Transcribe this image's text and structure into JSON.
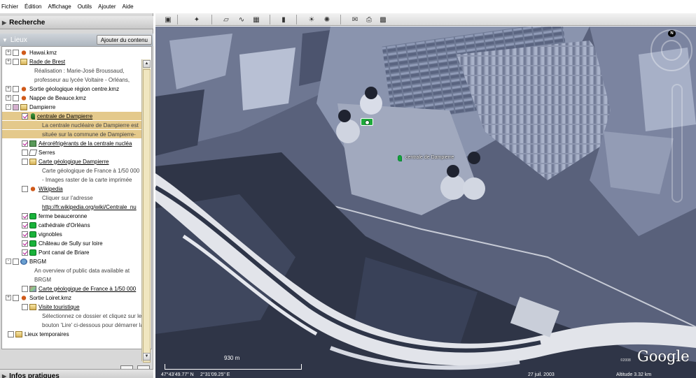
{
  "menu": [
    "Fichier",
    "Édition",
    "Affichage",
    "Outils",
    "Ajouter",
    "Aide"
  ],
  "panels": {
    "recherche": "Recherche",
    "lieux": "Lieux",
    "add_content": "Ajouter du contenu",
    "infos": "Infos pratiques"
  },
  "tree": [
    {
      "label": "Hawai.kmz",
      "icon": "kmz",
      "exp": "+",
      "check": "off"
    },
    {
      "label": "Rade de Brest",
      "icon": "folder",
      "exp": "+",
      "check": "off",
      "link": true
    },
    {
      "label": "Réalisation : Marie-José Broussaud,",
      "sub": true
    },
    {
      "label": "professeur au lycée Voltaire - Orléans,",
      "sub": true
    },
    {
      "label": "Sortie géologique région centre.kmz",
      "icon": "kmz",
      "exp": "+",
      "check": "off"
    },
    {
      "label": "Nappe de Beauce.kmz",
      "icon": "kmz",
      "exp": "+",
      "check": "off"
    },
    {
      "label": "Dampierre",
      "icon": "folder",
      "exp": "-",
      "check": "partial"
    },
    {
      "label": "centrale de Dampierre",
      "icon": "pin",
      "check": "on",
      "link": true,
      "selected": true
    },
    {
      "label": "La centrale nucléaire de Dampierre est",
      "sub": true,
      "selected": true
    },
    {
      "label": "située sur la commune de Dampierre-",
      "sub": true,
      "selected": true
    },
    {
      "label": "Aéroréfrigérants de la centrale nucléa",
      "icon": "photo",
      "check": "on",
      "link": true
    },
    {
      "label": "Serres",
      "icon": "poly",
      "check": "off"
    },
    {
      "label": "Carte géologique Dampierre",
      "icon": "folder",
      "check": "off",
      "link": true
    },
    {
      "label": "Carte géologique de France à 1/50 000",
      "sub": true
    },
    {
      "label": "- Images raster de la carte imprimée",
      "sub": true
    },
    {
      "label": "Wikipedia",
      "icon": "kmz",
      "check": "off",
      "link": true
    },
    {
      "label": "Cliquer sur l'adresse",
      "sub": true
    },
    {
      "label": "http://fr.wikipedia.org/wiki/Centrale_nu",
      "sub": true,
      "link": true
    },
    {
      "label": "ferme beauceronne",
      "icon": "green",
      "check": "on"
    },
    {
      "label": "cathédrale d'Orléans",
      "icon": "green",
      "check": "on"
    },
    {
      "label": "vignobles",
      "icon": "green",
      "check": "on"
    },
    {
      "label": "Château de Sully sur loire",
      "icon": "green",
      "check": "on"
    },
    {
      "label": "Pont canal de Briare",
      "icon": "green",
      "check": "on"
    },
    {
      "label": "BRGM",
      "icon": "globe",
      "exp": "-",
      "check": "off"
    },
    {
      "label": "An overview of public data available at",
      "sub": true
    },
    {
      "label": "BRGM",
      "sub": true
    },
    {
      "label": "Carte géologique de France à 1/50 000",
      "icon": "img",
      "check": "off",
      "link": true
    },
    {
      "label": "Sortie Loiret.kmz",
      "icon": "kmz",
      "exp": "+",
      "check": "off"
    },
    {
      "label": "Visite touristique",
      "icon": "folder",
      "check": "off",
      "link": true
    },
    {
      "label": "Sélectionnez ce dossier et cliquez sur le",
      "sub": true
    },
    {
      "label": "bouton 'Lire' ci-dessous pour démarrer la",
      "sub": true
    },
    {
      "label": "Lieux temporaires",
      "icon": "folder",
      "check": "off",
      "root": true
    }
  ],
  "map": {
    "placemark_label": "centrale de Dampierre",
    "scale": "930 m",
    "logo": "Google",
    "logo_copy": "©2008",
    "lat": "47°43'49.77\" N",
    "lon": "2°31'09.25\" E",
    "date": "27 juil. 2003",
    "altitude": "Altitude   3.32 km"
  },
  "colors": {
    "selection": "#e4c98b",
    "check": "#b0108f",
    "placemark": "#19a03a"
  }
}
